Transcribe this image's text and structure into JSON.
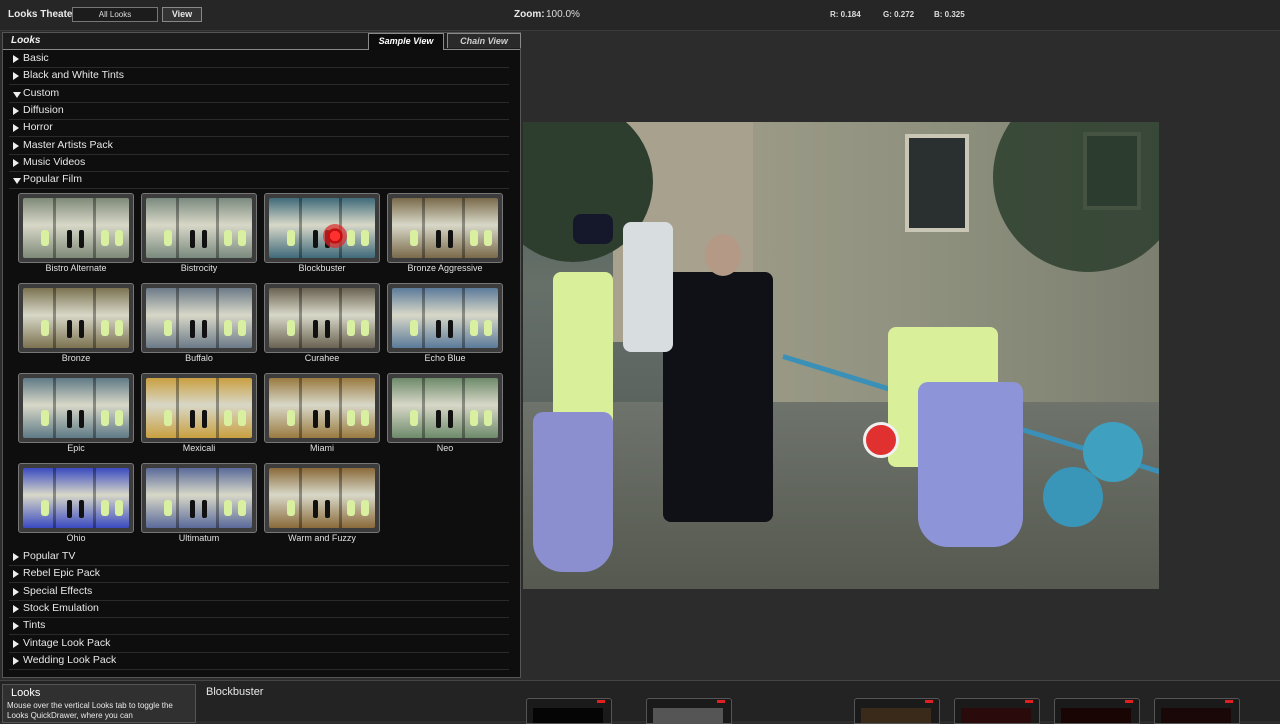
{
  "topbar": {
    "theater_label": "Looks Theater:",
    "dropdown_value": "All Looks",
    "view_button": "View",
    "zoom_label": "Zoom:",
    "zoom_value": "100.0%",
    "r": "R: 0.184",
    "g": "G: 0.272",
    "b": "B: 0.325"
  },
  "panel": {
    "title": "Looks",
    "tab_sample": "Sample View",
    "tab_chain": "Chain View",
    "categories_top": [
      {
        "label": "Basic",
        "state": "closed"
      },
      {
        "label": "Black and White Tints",
        "state": "closed"
      },
      {
        "label": "Custom",
        "state": "open"
      },
      {
        "label": "Diffusion",
        "state": "closed"
      },
      {
        "label": "Horror",
        "state": "closed"
      },
      {
        "label": "Master Artists Pack",
        "state": "closed"
      },
      {
        "label": "Music Videos",
        "state": "closed"
      },
      {
        "label": "Popular Film",
        "state": "open"
      }
    ],
    "looks": [
      {
        "label": "Bistro Alternate",
        "tone": "#7f8a78"
      },
      {
        "label": "Bistrocity",
        "tone": "#7a8a7e"
      },
      {
        "label": "Blockbuster",
        "tone": "#3f6a7a"
      },
      {
        "label": "Bronze Aggressive",
        "tone": "#7a6a4a"
      },
      {
        "label": "Bronze",
        "tone": "#7b7250"
      },
      {
        "label": "Buffalo",
        "tone": "#6c7a88"
      },
      {
        "label": "Curahee",
        "tone": "#6a6252"
      },
      {
        "label": "Echo Blue",
        "tone": "#5b7a9a"
      },
      {
        "label": "Epic",
        "tone": "#5f7a86"
      },
      {
        "label": "Mexicali",
        "tone": "#c9a040"
      },
      {
        "label": "Miami",
        "tone": "#9a7a40"
      },
      {
        "label": "Neo",
        "tone": "#6d8a6a"
      },
      {
        "label": "Ohio",
        "tone": "#3a4ac0"
      },
      {
        "label": "Ultimatum",
        "tone": "#5a6a9a"
      },
      {
        "label": "Warm and Fuzzy",
        "tone": "#8a6a3a"
      }
    ],
    "categories_bottom": [
      {
        "label": "Popular TV",
        "state": "closed"
      },
      {
        "label": "Rebel Epic Pack",
        "state": "closed"
      },
      {
        "label": "Special Effects",
        "state": "closed"
      },
      {
        "label": "Stock Emulation",
        "state": "closed"
      },
      {
        "label": "Tints",
        "state": "closed"
      },
      {
        "label": "Vintage Look Pack",
        "state": "closed"
      },
      {
        "label": "Wedding Look Pack",
        "state": "closed"
      }
    ]
  },
  "bottombar": {
    "info_title": "Looks",
    "info_text": "Mouse over the vertical Looks tab to toggle the Looks QuickDrawer, where you can",
    "selected_look": "Blockbuster"
  }
}
